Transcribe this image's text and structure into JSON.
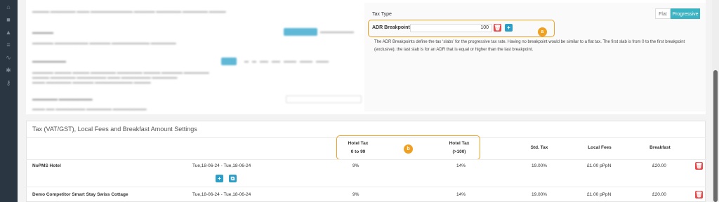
{
  "tax_type": {
    "label": "Tax Type",
    "options": [
      "Flat",
      "Progressive"
    ],
    "selected": "Progressive"
  },
  "adr": {
    "label": "ADR Breakpoints",
    "value": "100",
    "marker": "a",
    "description": "The ADR Breakpoints define the tax ‘slabs’ for the progressive tax rate. Having no breakpoint would be similar to a flat tax. The first slab is from 0 to the first breakpoint (exclusive); the last slab is for an ADR that is equal or higher than the last breakpoint."
  },
  "tax_section": {
    "title": "Tax (VAT/GST), Local Fees and Breakfast Amount Settings",
    "marker": "b",
    "headers": {
      "hotel_tax_1_line1": "Hotel Tax",
      "hotel_tax_1_line2": "0 to 99",
      "hotel_tax_2_line1": "Hotel Tax",
      "hotel_tax_2_line2": "(>100)",
      "std_tax": "Std. Tax",
      "local_fees": "Local Fees",
      "breakfast": "Breakfast"
    },
    "rows": [
      {
        "name": "NoPMS Hotel",
        "dates": "Tue,18-06-24 - Tue,18-06-24",
        "tax1": "9%",
        "tax2": "14%",
        "std": "19.00%",
        "fees": "£1.00 pPpN",
        "breakfast": "£20.00"
      },
      {
        "name": "Demo Competitor Smart Stay Swiss Cottage",
        "dates": "Tue,18-06-24 - Tue,18-06-24",
        "tax1": "9%",
        "tax2": "14%",
        "std": "19.00%",
        "fees": "£1.00 pPpN",
        "breakfast": "£20.00"
      }
    ]
  },
  "icons": {
    "delete": "trash-icon",
    "add": "plus-icon",
    "copy": "copy-icon"
  },
  "colors": {
    "accent": "#3bb3c3",
    "danger": "#e9494b",
    "callout": "#f0a020",
    "sidebar": "#2b3643"
  }
}
